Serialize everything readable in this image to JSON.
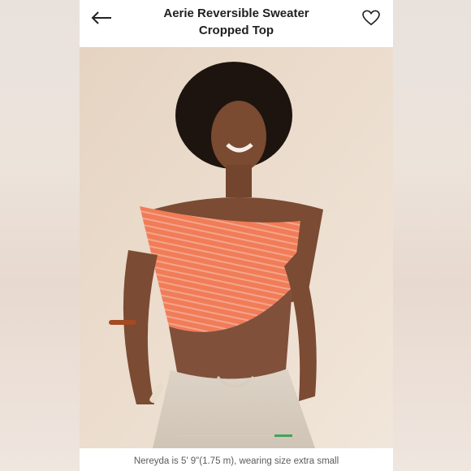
{
  "header": {
    "title_line1": "Aerie Reversible Sweater",
    "title_line2": "Cropped Top",
    "back_icon": "arrow-left-icon",
    "favorite_icon": "heart-outline-icon"
  },
  "photo": {
    "description_icon": "product-photo"
  },
  "pager": {
    "active_color": "#3fa45b"
  },
  "caption": {
    "text": "Nereyda is 5' 9\"(1.75 m), wearing size extra small"
  }
}
